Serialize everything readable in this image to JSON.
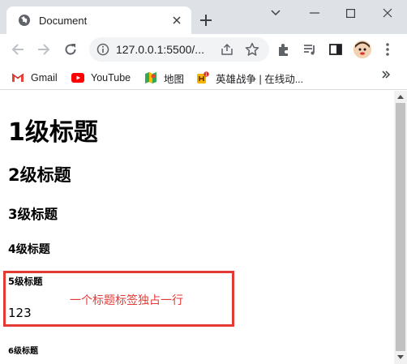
{
  "tab": {
    "title": "Document"
  },
  "address": {
    "url": "127.0.0.1:5500/..."
  },
  "bookmarks": [
    {
      "label": "Gmail",
      "icon": "gmail-icon"
    },
    {
      "label": "YouTube",
      "icon": "youtube-icon"
    },
    {
      "label": "地图",
      "icon": "maps-icon"
    },
    {
      "label": "英雄战争 | 在线动...",
      "icon": "game-icon"
    }
  ],
  "content": {
    "h1": "1级标题",
    "h2": "2级标题",
    "h3": "3级标题",
    "h4": "4级标题",
    "h5": "5级标题",
    "text": "123",
    "h6": "6级标题"
  },
  "annotation": {
    "text": "一个标题标签独占一行",
    "color": "#e53935"
  },
  "colors": {
    "tabstrip": "#dee1e6",
    "omnibox": "#f1f3f4"
  }
}
